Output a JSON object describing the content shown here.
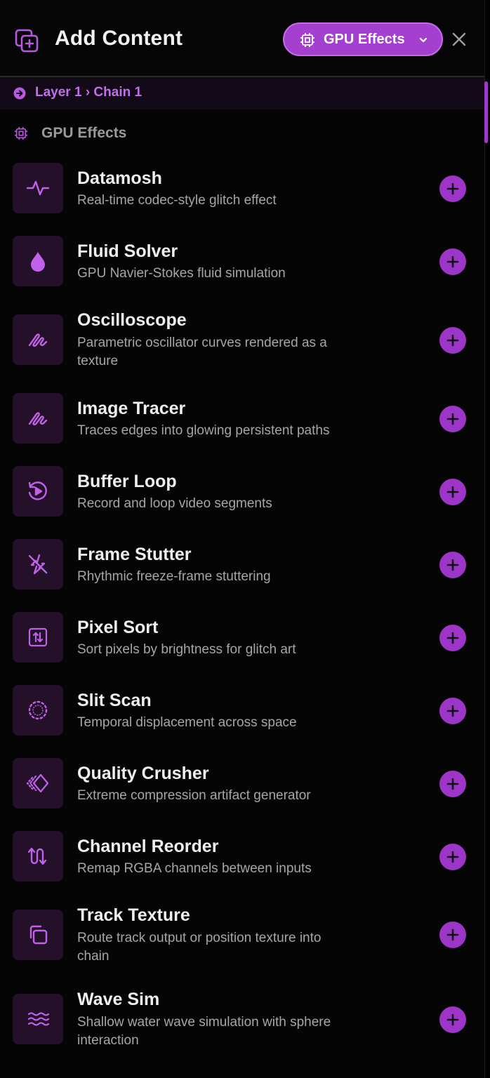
{
  "header": {
    "title": "Add Content",
    "dropdown_label": "GPU Effects",
    "dropdown_icon": "chip-icon",
    "close_icon": "close-icon"
  },
  "breadcrumb": {
    "text": "Layer 1 › Chain 1"
  },
  "section": {
    "title": "GPU Effects"
  },
  "colors": {
    "accent": "#a43fd0",
    "accent_text": "#c070e8",
    "icon_bg": "#241028",
    "background": "#050505"
  },
  "items": [
    {
      "title": "Datamosh",
      "desc": "Real-time codec-style glitch effect",
      "icon": "pulse-icon"
    },
    {
      "title": "Fluid Solver",
      "desc": "GPU Navier-Stokes fluid simulation",
      "icon": "droplet-icon"
    },
    {
      "title": "Oscilloscope",
      "desc": "Parametric oscillator curves rendered as a texture",
      "icon": "squiggle-icon"
    },
    {
      "title": "Image Tracer",
      "desc": "Traces edges into glowing persistent paths",
      "icon": "squiggle-icon"
    },
    {
      "title": "Buffer Loop",
      "desc": "Record and loop video segments",
      "icon": "loop-play-icon"
    },
    {
      "title": "Frame Stutter",
      "desc": "Rhythmic freeze-frame stuttering",
      "icon": "zap-off-icon"
    },
    {
      "title": "Pixel Sort",
      "desc": "Sort pixels by brightness for glitch art",
      "icon": "sort-arrows-icon"
    },
    {
      "title": "Slit Scan",
      "desc": "Temporal displacement across space",
      "icon": "dashed-circle-icon"
    },
    {
      "title": "Quality Crusher",
      "desc": "Extreme compression artifact generator",
      "icon": "diamond-chevrons-icon"
    },
    {
      "title": "Channel Reorder",
      "desc": "Remap RGBA channels between inputs",
      "icon": "swap-arrows-icon"
    },
    {
      "title": "Track Texture",
      "desc": "Route track output or position texture into chain",
      "icon": "copy-squares-icon"
    },
    {
      "title": "Wave Sim",
      "desc": "Shallow water wave simulation with sphere interaction",
      "icon": "waves-icon"
    }
  ]
}
